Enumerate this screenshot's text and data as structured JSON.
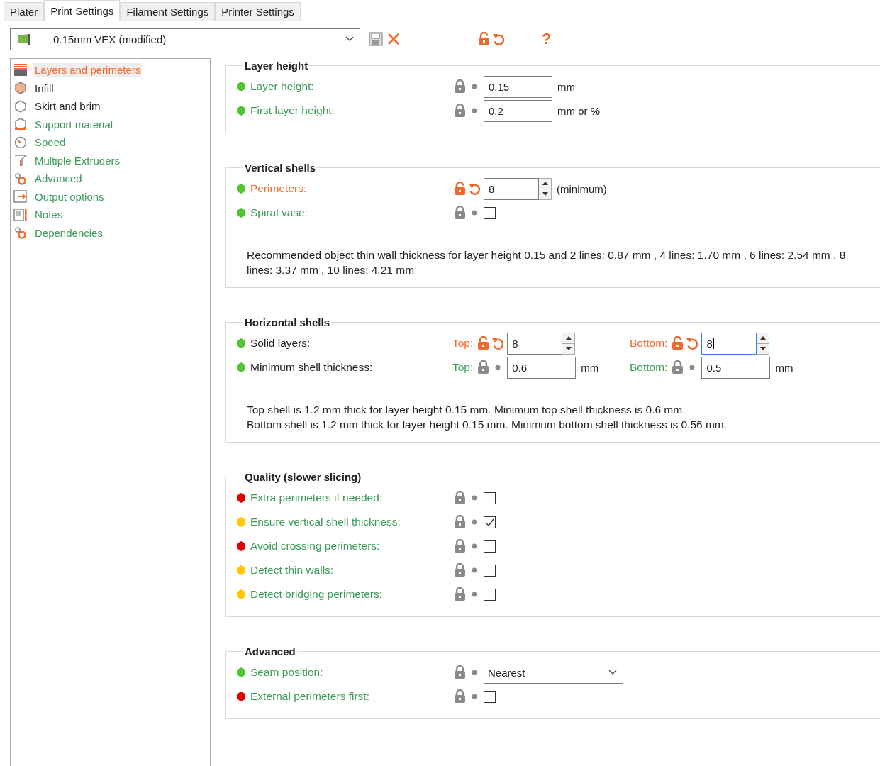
{
  "tabs": [
    {
      "label": "Plater",
      "selected": false
    },
    {
      "label": "Print Settings",
      "selected": true
    },
    {
      "label": "Filament Settings",
      "selected": false
    },
    {
      "label": "Printer Settings",
      "selected": false
    }
  ],
  "preset": {
    "name": "0.15mm VEX (modified)",
    "locked": false,
    "modified": true,
    "help": "?"
  },
  "sidebar": [
    {
      "label": "Layers and perimeters",
      "selected": true,
      "modified": true,
      "system": false
    },
    {
      "label": "Infill",
      "selected": false,
      "modified": false,
      "system": false
    },
    {
      "label": "Skirt and brim",
      "selected": false,
      "modified": false,
      "system": false
    },
    {
      "label": "Support material",
      "selected": false,
      "modified": false,
      "system": true
    },
    {
      "label": "Speed",
      "selected": false,
      "modified": false,
      "system": true
    },
    {
      "label": "Multiple Extruders",
      "selected": false,
      "modified": false,
      "system": true
    },
    {
      "label": "Advanced",
      "selected": false,
      "modified": false,
      "system": true
    },
    {
      "label": "Output options",
      "selected": false,
      "modified": false,
      "system": true
    },
    {
      "label": "Notes",
      "selected": false,
      "modified": false,
      "system": true
    },
    {
      "label": "Dependencies",
      "selected": false,
      "modified": false,
      "system": true
    }
  ],
  "sections": [
    {
      "title": "Layer height",
      "options": [
        {
          "kind": "text",
          "label": "Layer height:",
          "color": "#52c534",
          "locked": true,
          "modified": false,
          "value": "0.15",
          "unit": "mm"
        },
        {
          "kind": "text",
          "label": "First layer height:",
          "color": "#52c534",
          "locked": true,
          "modified": false,
          "value": "0.2",
          "unit": "mm or %"
        }
      ]
    },
    {
      "title": "Vertical shells",
      "options": [
        {
          "kind": "spin",
          "label": "Perimeters:",
          "color": "#52c534",
          "locked": false,
          "modified": true,
          "value": "8",
          "unit": "(minimum)",
          "focused": false
        },
        {
          "kind": "checkbox",
          "label": "Spiral vase:",
          "color": "#52c534",
          "locked": true,
          "modified": false,
          "checked": false
        }
      ],
      "notes": [
        "Recommended object thin wall thickness for layer height 0.15 and 2 lines: 0.87 mm , 4 lines: 1.70 mm , 6 lines: 2.54 mm , 8 lines: 3.37 mm , 10 lines: 4.21 mm"
      ]
    },
    {
      "title": "Horizontal shells",
      "options": [
        {
          "kind": "pair",
          "label": "Solid layers:",
          "color": "#52c534",
          "system": false,
          "parts": [
            {
              "kind": "spin",
              "sublabel": "Top:",
              "locked": false,
              "modified": true,
              "value": "8",
              "focused": false
            },
            {
              "kind": "spin",
              "sublabel": "Bottom:",
              "locked": false,
              "modified": true,
              "value": "8",
              "focused": true
            }
          ]
        },
        {
          "kind": "pair",
          "label": "Minimum shell thickness:",
          "color": "#52c534",
          "system": false,
          "parts": [
            {
              "kind": "text",
              "sublabel": "Top:",
              "locked": true,
              "modified": false,
              "value": "0.6",
              "unit": "mm"
            },
            {
              "kind": "text",
              "sublabel": "Bottom:",
              "locked": true,
              "modified": false,
              "value": "0.5",
              "unit": "mm"
            }
          ]
        }
      ],
      "notes": [
        "Top shell is 1.2 mm thick for layer height 0.15 mm. Minimum top shell thickness is 0.6 mm.",
        "Bottom shell is 1.2 mm thick for layer height 0.15 mm. Minimum bottom shell thickness is 0.56 mm."
      ]
    },
    {
      "title": "Quality (slower slicing)",
      "options": [
        {
          "kind": "checkbox",
          "label": "Extra perimeters if needed:",
          "color": "#e00000",
          "locked": true,
          "modified": false,
          "checked": false
        },
        {
          "kind": "checkbox",
          "label": "Ensure vertical shell thickness:",
          "color": "#ffc800",
          "locked": true,
          "modified": false,
          "checked": true
        },
        {
          "kind": "checkbox",
          "label": "Avoid crossing perimeters:",
          "color": "#e00000",
          "locked": true,
          "modified": false,
          "checked": false
        },
        {
          "kind": "checkbox",
          "label": "Detect thin walls:",
          "color": "#ffc800",
          "locked": true,
          "modified": false,
          "checked": false
        },
        {
          "kind": "checkbox",
          "label": "Detect bridging perimeters:",
          "color": "#ffc800",
          "locked": true,
          "modified": false,
          "checked": false
        }
      ]
    },
    {
      "title": "Advanced",
      "options": [
        {
          "kind": "select",
          "label": "Seam position:",
          "color": "#52c534",
          "locked": true,
          "modified": false,
          "value": "Nearest"
        },
        {
          "kind": "checkbox",
          "label": "External perimeters first:",
          "color": "#e00000",
          "locked": true,
          "modified": false,
          "checked": false
        }
      ]
    }
  ]
}
